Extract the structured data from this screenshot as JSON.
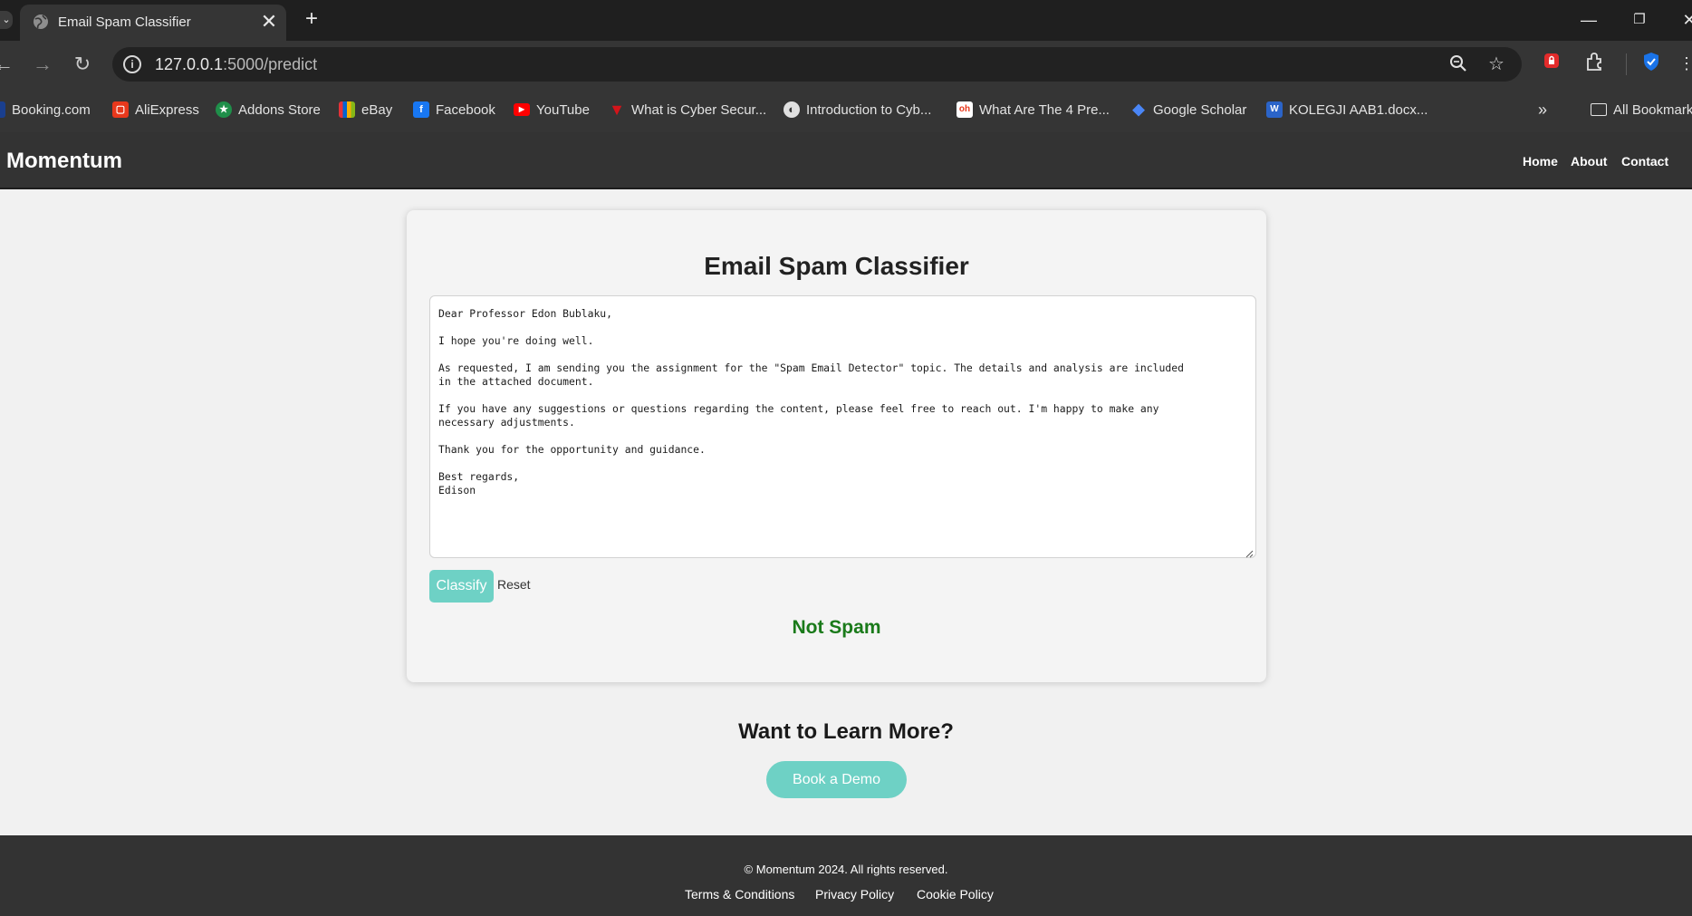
{
  "browser": {
    "tab_title": "Email Spam Classifier",
    "url_host": "127.0.0.1",
    "url_rest": ":5000/predict",
    "bookmarks": [
      {
        "label": "Booking.com",
        "icon": "booking-icon",
        "color": "#1a3f8f"
      },
      {
        "label": "AliExpress",
        "icon": "aliexpress-icon",
        "color": "#e8381c"
      },
      {
        "label": "Addons Store",
        "icon": "addons-store-icon",
        "color": "#1f8f4a"
      },
      {
        "label": "eBay",
        "icon": "ebay-icon",
        "color": "#e53238"
      },
      {
        "label": "Facebook",
        "icon": "facebook-icon",
        "color": "#1877f2"
      },
      {
        "label": "YouTube",
        "icon": "youtube-icon",
        "color": "#ff0000"
      },
      {
        "label": "What is Cyber Secur...",
        "icon": "cyber-security-icon",
        "color": "#d4141a"
      },
      {
        "label": "Introduction to Cyb...",
        "icon": "globe-icon",
        "color": "#9a9a9a"
      },
      {
        "label": "What Are The 4 Pre...",
        "icon": "oh-icon",
        "color": "#ffffff"
      },
      {
        "label": "Google Scholar",
        "icon": "google-scholar-icon",
        "color": "#4a86f7"
      },
      {
        "label": "KOLEGJI AAB1.docx...",
        "icon": "word-doc-icon",
        "color": "#2b64c8"
      }
    ],
    "all_bookmarks_label": "All Bookmarks"
  },
  "site": {
    "brand": "Momentum",
    "nav": [
      "Home",
      "About",
      "Contact"
    ]
  },
  "classifier": {
    "title": "Email Spam Classifier",
    "email_text": "Dear Professor Edon Bublaku,\n\nI hope you're doing well.\n\nAs requested, I am sending you the assignment for the \"Spam Email Detector\" topic. The details and analysis are included\nin the attached document.\n\nIf you have any suggestions or questions regarding the content, please feel free to reach out. I'm happy to make any\nnecessary adjustments.\n\nThank you for the opportunity and guidance.\n\nBest regards,\nEdison",
    "classify_label": "Classify",
    "reset_label": "Reset",
    "result": "Not Spam",
    "result_color": "#1a7a1a"
  },
  "learn_more": {
    "title": "Want to Learn More?",
    "button": "Book a Demo"
  },
  "footer": {
    "copyright": "© Momentum 2024. All rights reserved.",
    "links": [
      "Terms & Conditions",
      "Privacy Policy",
      "Cookie Policy"
    ]
  },
  "colors": {
    "accent": "#6ed1c5",
    "header_bg": "#333333"
  }
}
